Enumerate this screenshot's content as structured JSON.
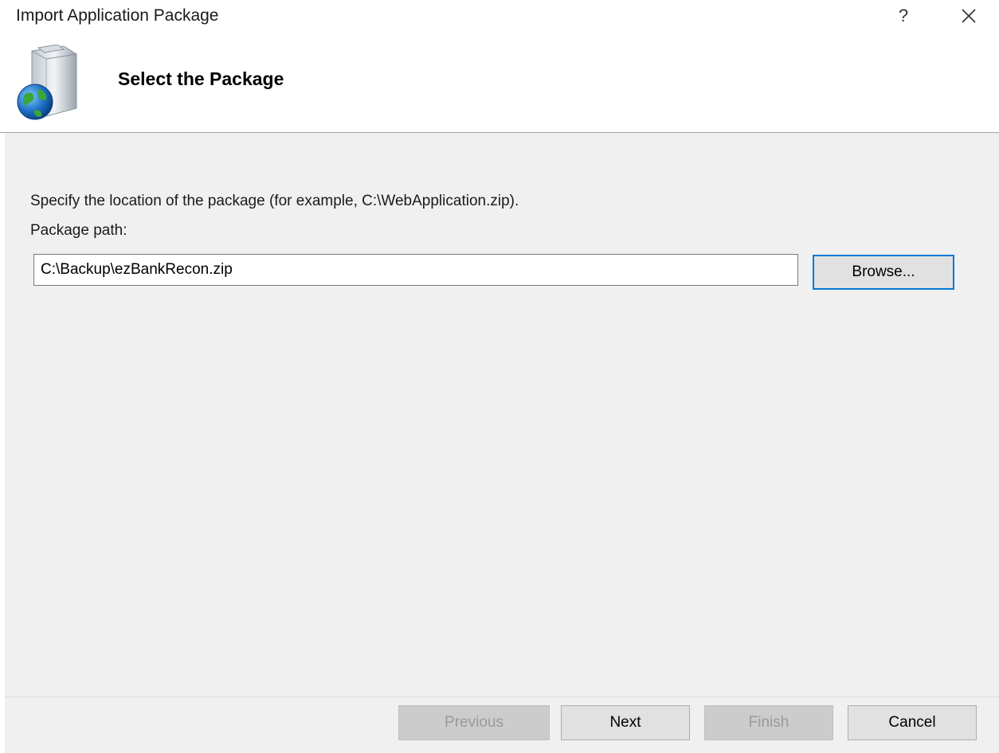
{
  "window": {
    "title": "Import Application Package",
    "help_label": "?",
    "close_icon": "close-icon"
  },
  "header": {
    "title": "Select the Package",
    "icon": "package-globe-icon"
  },
  "content": {
    "instruction": "Specify the location of the package (for example, C:\\WebApplication.zip).",
    "path_label": "Package path:",
    "path_value": "C:\\Backup\\ezBankRecon.zip",
    "browse_label": "Browse..."
  },
  "footer": {
    "previous_label": "Previous",
    "next_label": "Next",
    "finish_label": "Finish",
    "cancel_label": "Cancel"
  },
  "colors": {
    "focus_accent": "#0078d7",
    "panel_bg": "#f0f0f0",
    "disabled_button": "#cccccc"
  }
}
